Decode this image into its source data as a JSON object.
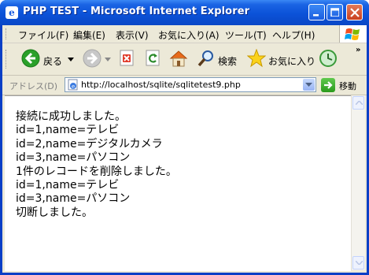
{
  "window": {
    "title": "PHP TEST - Microsoft Internet Explorer",
    "app_icon": "ie-logo-icon",
    "controls": [
      "minimize-icon",
      "maximize-icon",
      "close-icon"
    ]
  },
  "menubar": {
    "items": [
      "ファイル(F)",
      "編集(E)",
      "表示(V)",
      "お気に入り(A)",
      "ツール(T)",
      "ヘルプ(H)"
    ]
  },
  "toolbar": {
    "back_label": "戻る",
    "search_label": "検索",
    "favorites_label": "お気に入り",
    "more": "»"
  },
  "addressbar": {
    "label": "アドレス(D)",
    "url": "http://localhost/sqlite/sqlitetest9.php",
    "go_label": "移動"
  },
  "content": {
    "lines": [
      "接続に成功しました。",
      "id=1,name=テレビ",
      "id=2,name=デジタルカメラ",
      "id=3,name=パソコン",
      "1件のレコードを削除しました。",
      "id=1,name=テレビ",
      "id=3,name=パソコン",
      "切断しました。"
    ]
  },
  "colors": {
    "titlebar": "#0a47c6",
    "chrome": "#ece9d8",
    "back_icon": "#2aa02a",
    "go_button": "#2a9a1c"
  }
}
